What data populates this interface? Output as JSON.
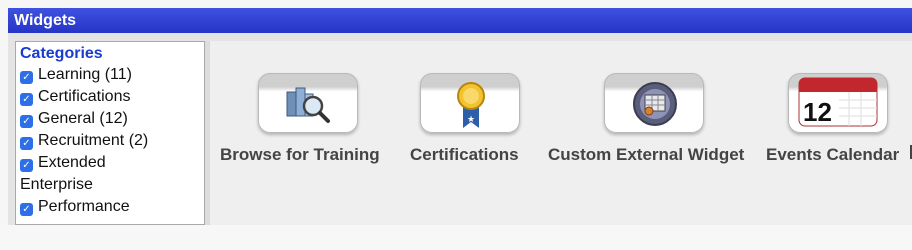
{
  "window": {
    "title": "Widgets"
  },
  "categories": {
    "heading": "Categories",
    "items": [
      {
        "label": "Learning (11)",
        "checked": true
      },
      {
        "label": "Certifications",
        "checked": true
      },
      {
        "label": "General (12)",
        "checked": true
      },
      {
        "label": "Recruitment (2)",
        "checked": true
      },
      {
        "label": "Extended Enterprise",
        "checked": true
      },
      {
        "label": "Performance",
        "checked": true
      }
    ]
  },
  "widgets": [
    {
      "label": "Browse for Training",
      "icon": "magnifier-books-icon"
    },
    {
      "label": "Certifications",
      "icon": "award-ribbon-icon"
    },
    {
      "label": "Custom External Widget",
      "icon": "custom-widget-icon"
    },
    {
      "label": "Events Calendar",
      "icon": "calendar-icon",
      "calendar_day": "12"
    }
  ],
  "colors": {
    "titlebar": "#2f41d6",
    "category_heading": "#1a3bd0",
    "checkbox": "#2c6fe8"
  }
}
